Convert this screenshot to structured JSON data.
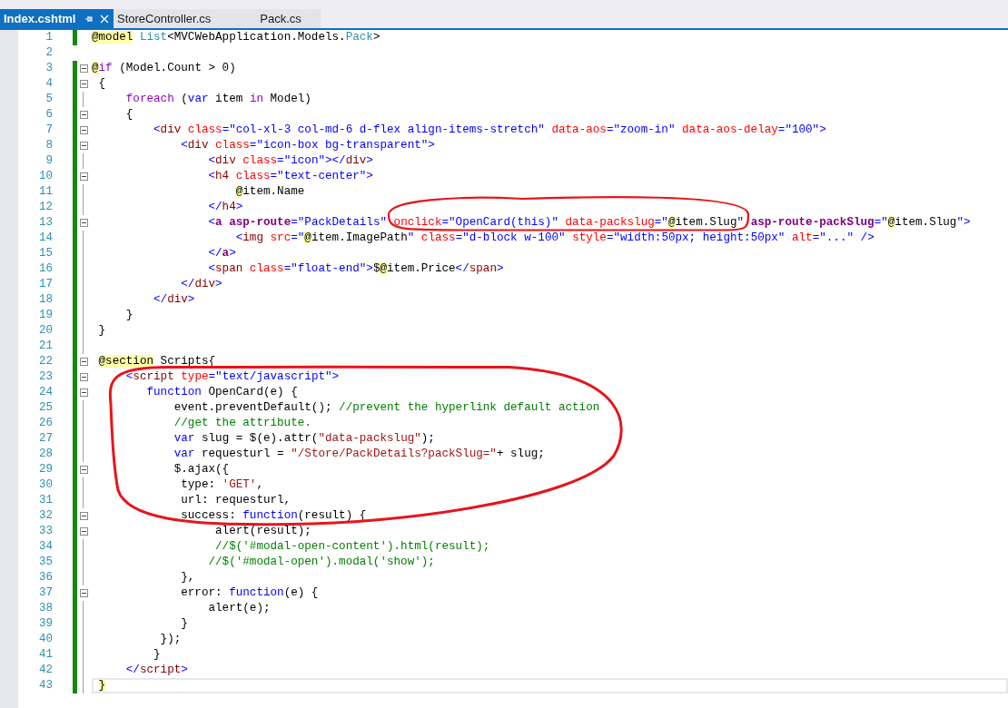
{
  "tabs": [
    {
      "label": "Index.cshtml",
      "selected": true
    },
    {
      "label": "StoreController.cs",
      "selected": false
    },
    {
      "label": "Pack.cs",
      "selected": false
    }
  ],
  "editor": {
    "lines": [
      {
        "n": "1",
        "fold": false,
        "changed": true,
        "current": false,
        "tokens": [
          {
            "kind": "razor",
            "text": "@model"
          },
          {
            "kind": "type",
            "text": " List"
          },
          {
            "kind": "plain",
            "text": "<MVCWebApplication.Models."
          },
          {
            "kind": "type",
            "text": "Pack"
          },
          {
            "kind": "plain",
            "text": ">"
          }
        ]
      },
      {
        "n": "2",
        "fold": false,
        "changed": false,
        "current": false
      },
      {
        "n": "3",
        "fold": true,
        "changed": true,
        "current": false,
        "tokens": [
          {
            "kind": "razor",
            "text": "@"
          },
          {
            "kind": "control",
            "text": "if"
          },
          {
            "kind": "plain",
            "text": " (Model.Count > 0)"
          }
        ]
      },
      {
        "n": "4",
        "fold": true,
        "changed": true,
        "current": false,
        "tokens": [
          {
            "kind": "plain",
            "text": " {"
          }
        ]
      },
      {
        "n": "5",
        "fold": false,
        "changed": true,
        "current": false,
        "tokens": [
          {
            "kind": "control",
            "text": "     foreach"
          },
          {
            "kind": "plain",
            "text": " ("
          },
          {
            "kind": "keyword",
            "text": "var"
          },
          {
            "kind": "plain",
            "text": " item "
          },
          {
            "kind": "control",
            "text": "in"
          },
          {
            "kind": "plain",
            "text": " Model)"
          }
        ]
      },
      {
        "n": "6",
        "fold": true,
        "changed": true,
        "current": false,
        "tokens": [
          {
            "kind": "plain",
            "text": "     {"
          }
        ]
      },
      {
        "n": "7",
        "fold": true,
        "changed": true,
        "current": false,
        "tokens": [
          {
            "kind": "markup",
            "text": "         <"
          },
          {
            "kind": "tag",
            "text": "div"
          },
          {
            "kind": "attr",
            "text": " class"
          },
          {
            "kind": "markup",
            "text": "=\"col-xl-3 col-md-6 d-flex align-items-stretch\""
          },
          {
            "kind": "attr",
            "text": " data-aos"
          },
          {
            "kind": "markup",
            "text": "=\"zoom-in\""
          },
          {
            "kind": "attr",
            "text": " data-aos-delay"
          },
          {
            "kind": "markup",
            "text": "=\"100\">"
          }
        ]
      },
      {
        "n": "8",
        "fold": true,
        "changed": true,
        "current": false,
        "tokens": [
          {
            "kind": "markup",
            "text": "             <"
          },
          {
            "kind": "tag",
            "text": "div"
          },
          {
            "kind": "attr",
            "text": " class"
          },
          {
            "kind": "markup",
            "text": "=\"icon-box bg-transparent\">"
          }
        ]
      },
      {
        "n": "9",
        "fold": false,
        "changed": true,
        "current": false,
        "tokens": [
          {
            "kind": "markup",
            "text": "                 <"
          },
          {
            "kind": "tag",
            "text": "div"
          },
          {
            "kind": "attr",
            "text": " class"
          },
          {
            "kind": "markup",
            "text": "=\"icon\"></"
          },
          {
            "kind": "tag",
            "text": "div"
          },
          {
            "kind": "markup",
            "text": ">"
          }
        ]
      },
      {
        "n": "10",
        "fold": true,
        "changed": true,
        "current": false,
        "tokens": [
          {
            "kind": "markup",
            "text": "                 <"
          },
          {
            "kind": "tag",
            "text": "h4"
          },
          {
            "kind": "attr",
            "text": " class"
          },
          {
            "kind": "markup",
            "text": "=\"text-center\">"
          }
        ]
      },
      {
        "n": "11",
        "fold": false,
        "changed": true,
        "current": false,
        "tokens": [
          {
            "kind": "razor",
            "text": "                     @"
          },
          {
            "kind": "plain",
            "text": "item.Name"
          }
        ]
      },
      {
        "n": "12",
        "fold": false,
        "changed": true,
        "current": false,
        "tokens": [
          {
            "kind": "markup",
            "text": "                 </"
          },
          {
            "kind": "tag",
            "text": "h4"
          },
          {
            "kind": "markup",
            "text": ">"
          }
        ]
      },
      {
        "n": "13",
        "fold": true,
        "changed": true,
        "current": false,
        "tokens": [
          {
            "kind": "markup",
            "text": "                 <"
          },
          {
            "kind": "helper",
            "text": "a"
          },
          {
            "kind": "helper",
            "text": " asp-route"
          },
          {
            "kind": "markup",
            "text": "=\"PackDetails\""
          },
          {
            "kind": "attr",
            "text": " onclick"
          },
          {
            "kind": "markup",
            "text": "=\"OpenCard(this)\""
          },
          {
            "kind": "attr",
            "text": " data-packslug"
          },
          {
            "kind": "markup",
            "text": "=\""
          },
          {
            "kind": "razor",
            "text": "@"
          },
          {
            "kind": "plain",
            "text": "item.Slug"
          },
          {
            "kind": "markup",
            "text": "\""
          },
          {
            "kind": "helper",
            "text": " asp-route-packSlug"
          },
          {
            "kind": "markup",
            "text": "=\""
          },
          {
            "kind": "razor",
            "text": "@"
          },
          {
            "kind": "plain",
            "text": "item.Slug"
          },
          {
            "kind": "markup",
            "text": "\">"
          }
        ]
      },
      {
        "n": "14",
        "fold": false,
        "changed": true,
        "current": false,
        "tokens": [
          {
            "kind": "markup",
            "text": "                     <"
          },
          {
            "kind": "tag",
            "text": "img"
          },
          {
            "kind": "attr",
            "text": " src"
          },
          {
            "kind": "markup",
            "text": "=\""
          },
          {
            "kind": "razor",
            "text": "@"
          },
          {
            "kind": "plain",
            "text": "item.ImagePath"
          },
          {
            "kind": "markup",
            "text": "\""
          },
          {
            "kind": "attr",
            "text": " class"
          },
          {
            "kind": "markup",
            "text": "=\"d-block w-100\""
          },
          {
            "kind": "attr",
            "text": " style"
          },
          {
            "kind": "markup",
            "text": "=\"width:50px; height:50px\""
          },
          {
            "kind": "attr",
            "text": " alt"
          },
          {
            "kind": "markup",
            "text": "=\"...\" />"
          }
        ]
      },
      {
        "n": "15",
        "fold": false,
        "changed": true,
        "current": false,
        "tokens": [
          {
            "kind": "markup",
            "text": "                 </"
          },
          {
            "kind": "helper",
            "text": "a"
          },
          {
            "kind": "markup",
            "text": ">"
          }
        ]
      },
      {
        "n": "16",
        "fold": false,
        "changed": true,
        "current": false,
        "tokens": [
          {
            "kind": "markup",
            "text": "                 <"
          },
          {
            "kind": "tag",
            "text": "span"
          },
          {
            "kind": "attr",
            "text": " class"
          },
          {
            "kind": "markup",
            "text": "=\"float-end\">"
          },
          {
            "kind": "plain",
            "text": "$"
          },
          {
            "kind": "razor",
            "text": "@"
          },
          {
            "kind": "plain",
            "text": "item.Price"
          },
          {
            "kind": "markup",
            "text": "</"
          },
          {
            "kind": "tag",
            "text": "span"
          },
          {
            "kind": "markup",
            "text": ">"
          }
        ]
      },
      {
        "n": "17",
        "fold": false,
        "changed": true,
        "current": false,
        "tokens": [
          {
            "kind": "markup",
            "text": "             </"
          },
          {
            "kind": "tag",
            "text": "div"
          },
          {
            "kind": "markup",
            "text": ">"
          }
        ]
      },
      {
        "n": "18",
        "fold": false,
        "changed": true,
        "current": false,
        "tokens": [
          {
            "kind": "markup",
            "text": "         </"
          },
          {
            "kind": "tag",
            "text": "div"
          },
          {
            "kind": "markup",
            "text": ">"
          }
        ]
      },
      {
        "n": "19",
        "fold": false,
        "changed": true,
        "current": false,
        "tokens": [
          {
            "kind": "plain",
            "text": "     }"
          }
        ]
      },
      {
        "n": "20",
        "fold": false,
        "changed": true,
        "current": false,
        "tokens": [
          {
            "kind": "plain",
            "text": " }"
          }
        ]
      },
      {
        "n": "21",
        "fold": false,
        "changed": true,
        "current": false
      },
      {
        "n": "22",
        "fold": true,
        "changed": true,
        "current": false,
        "tokens": [
          {
            "kind": "razor",
            "text": " @section"
          },
          {
            "kind": "plain",
            "text": " Scripts{"
          }
        ]
      },
      {
        "n": "23",
        "fold": true,
        "changed": true,
        "current": false,
        "tokens": [
          {
            "kind": "markup",
            "text": "     <"
          },
          {
            "kind": "tag",
            "text": "script"
          },
          {
            "kind": "attr",
            "text": " type"
          },
          {
            "kind": "markup",
            "text": "=\"text/javascript\">"
          }
        ]
      },
      {
        "n": "24",
        "fold": true,
        "changed": true,
        "current": false,
        "tokens": [
          {
            "kind": "keyword",
            "text": "        function"
          },
          {
            "kind": "plain",
            "text": " OpenCard(e) {"
          }
        ]
      },
      {
        "n": "25",
        "fold": false,
        "changed": true,
        "current": false,
        "tokens": [
          {
            "kind": "plain",
            "text": "            event.preventDefault();"
          },
          {
            "kind": "comment",
            "text": " //prevent the hyperlink default action"
          }
        ]
      },
      {
        "n": "26",
        "fold": false,
        "changed": true,
        "current": false,
        "tokens": [
          {
            "kind": "comment",
            "text": "            //get the attribute."
          }
        ]
      },
      {
        "n": "27",
        "fold": false,
        "changed": true,
        "current": false,
        "tokens": [
          {
            "kind": "keyword",
            "text": "            var"
          },
          {
            "kind": "plain",
            "text": " slug = $(e).attr("
          },
          {
            "kind": "jsstring",
            "text": "\"data-packslug\""
          },
          {
            "kind": "plain",
            "text": ");"
          }
        ]
      },
      {
        "n": "28",
        "fold": false,
        "changed": true,
        "current": false,
        "tokens": [
          {
            "kind": "keyword",
            "text": "            var"
          },
          {
            "kind": "plain",
            "text": " requesturl = "
          },
          {
            "kind": "jsstring",
            "text": "\"/Store/PackDetails?packSlug=\""
          },
          {
            "kind": "plain",
            "text": "+ slug;"
          }
        ]
      },
      {
        "n": "29",
        "fold": true,
        "changed": true,
        "current": false,
        "tokens": [
          {
            "kind": "plain",
            "text": "            $.ajax({"
          }
        ]
      },
      {
        "n": "30",
        "fold": false,
        "changed": true,
        "current": false,
        "tokens": [
          {
            "kind": "plain",
            "text": "             type: "
          },
          {
            "kind": "jsstring",
            "text": "'GET'"
          },
          {
            "kind": "plain",
            "text": ","
          }
        ]
      },
      {
        "n": "31",
        "fold": false,
        "changed": true,
        "current": false,
        "tokens": [
          {
            "kind": "plain",
            "text": "             url: requesturl,"
          }
        ]
      },
      {
        "n": "32",
        "fold": true,
        "changed": true,
        "current": false,
        "tokens": [
          {
            "kind": "plain",
            "text": "             success: "
          },
          {
            "kind": "keyword",
            "text": "function"
          },
          {
            "kind": "plain",
            "text": "(result) {"
          }
        ]
      },
      {
        "n": "33",
        "fold": true,
        "changed": true,
        "current": false,
        "tokens": [
          {
            "kind": "plain",
            "text": "                  alert(result);"
          }
        ]
      },
      {
        "n": "34",
        "fold": false,
        "changed": true,
        "current": false,
        "tokens": [
          {
            "kind": "comment",
            "text": "                  //$('#modal-open-content').html(result);"
          }
        ]
      },
      {
        "n": "35",
        "fold": false,
        "changed": true,
        "current": false,
        "tokens": [
          {
            "kind": "comment",
            "text": "                 //$('#modal-open').modal('show');"
          }
        ]
      },
      {
        "n": "36",
        "fold": false,
        "changed": true,
        "current": false,
        "tokens": [
          {
            "kind": "plain",
            "text": "             },"
          }
        ]
      },
      {
        "n": "37",
        "fold": true,
        "changed": true,
        "current": false,
        "tokens": [
          {
            "kind": "plain",
            "text": "             error: "
          },
          {
            "kind": "keyword",
            "text": "function"
          },
          {
            "kind": "plain",
            "text": "(e) {"
          }
        ]
      },
      {
        "n": "38",
        "fold": false,
        "changed": true,
        "current": false,
        "tokens": [
          {
            "kind": "plain",
            "text": "                 alert(e);"
          }
        ]
      },
      {
        "n": "39",
        "fold": false,
        "changed": true,
        "current": false,
        "tokens": [
          {
            "kind": "plain",
            "text": "             }"
          }
        ]
      },
      {
        "n": "40",
        "fold": false,
        "changed": true,
        "current": false,
        "tokens": [
          {
            "kind": "plain",
            "text": "          });"
          }
        ]
      },
      {
        "n": "41",
        "fold": false,
        "changed": true,
        "current": false,
        "tokens": [
          {
            "kind": "plain",
            "text": "         }"
          }
        ]
      },
      {
        "n": "42",
        "fold": false,
        "changed": true,
        "current": false,
        "tokens": [
          {
            "kind": "markup",
            "text": "     </"
          },
          {
            "kind": "tag",
            "text": "script"
          },
          {
            "kind": "markup",
            "text": ">"
          }
        ]
      },
      {
        "n": "43",
        "fold": false,
        "changed": true,
        "current": true,
        "tokens": [
          {
            "kind": "razor",
            "text": " }"
          }
        ]
      }
    ]
  }
}
